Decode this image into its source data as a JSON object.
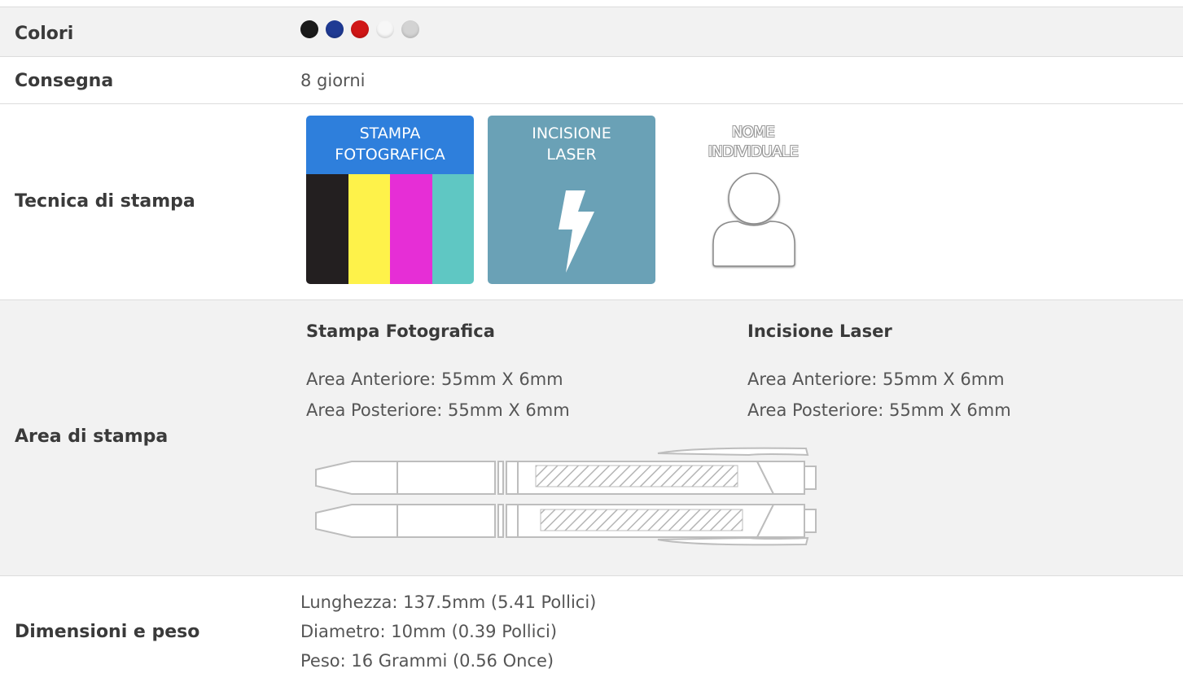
{
  "colors": {
    "label": "Colori",
    "swatches": [
      {
        "name": "black",
        "hex": "#1a1a1a"
      },
      {
        "name": "blue",
        "hex": "#1f3a93"
      },
      {
        "name": "red",
        "hex": "#d01616"
      },
      {
        "name": "white",
        "hex": "#f7f7f7"
      },
      {
        "name": "silver",
        "hex": "#d3d3d3"
      }
    ]
  },
  "delivery": {
    "label": "Consegna",
    "value": "8 giorni"
  },
  "technique": {
    "label": "Tecnica di stampa",
    "photo": {
      "line1": "STAMPA",
      "line2": "FOTOGRAFICA",
      "header_color": "#2e7fdc",
      "cmyk": [
        "#231f20",
        "#fef24a",
        "#e62ed6",
        "#5fc7c3"
      ]
    },
    "laser": {
      "line1": "INCISIONE",
      "line2": "LASER",
      "color": "#6aa1b6"
    },
    "name": {
      "line1": "NOME",
      "line2": "INDIVIDUALE"
    }
  },
  "print_area": {
    "label": "Area di stampa",
    "photo": {
      "title": "Stampa Fotografica",
      "front": "Area Anteriore: 55mm X 6mm",
      "back": "Area Posteriore: 55mm X 6mm"
    },
    "laser": {
      "title": "Incisione Laser",
      "front": "Area Anteriore: 55mm X 6mm",
      "back": "Area Posteriore: 55mm X 6mm"
    }
  },
  "dimensions": {
    "label": "Dimensioni e peso",
    "length": "Lunghezza: 137.5mm (5.41 Pollici)",
    "diameter": "Diametro: 10mm (0.39 Pollici)",
    "weight": "Peso: 16 Grammi (0.56 Once)"
  }
}
